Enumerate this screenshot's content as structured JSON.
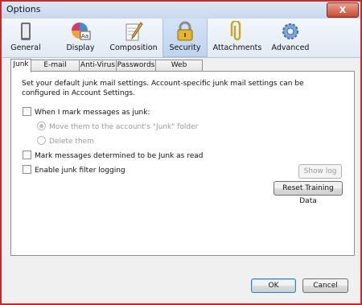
{
  "window": {
    "title": "Options",
    "close_label": "X"
  },
  "toolbar": {
    "items": [
      {
        "label": "General",
        "icon": "general-icon"
      },
      {
        "label": "Display",
        "icon": "display-icon"
      },
      {
        "label": "Composition",
        "icon": "composition-icon"
      },
      {
        "label": "Security",
        "icon": "security-icon",
        "active": true
      },
      {
        "label": "Attachments",
        "icon": "attachments-icon"
      },
      {
        "label": "Advanced",
        "icon": "advanced-icon"
      }
    ]
  },
  "tabs": [
    "Junk",
    "E-mail Scams",
    "Anti-Virus",
    "Passwords",
    "Web Content"
  ],
  "junk": {
    "description": "Set your default junk mail settings. Account-specific junk mail settings can be configured in Account Settings.",
    "when_mark_junk": "When I mark messages as junk:",
    "move_option": "Move them to the account's \"Junk\" folder",
    "delete_option": "Delete them",
    "mark_read": "Mark messages determined to be Junk as read",
    "enable_logging": "Enable junk filter logging",
    "show_log": "Show log",
    "reset_training": "Reset Training Data"
  },
  "dialog": {
    "ok": "OK",
    "cancel": "Cancel"
  }
}
